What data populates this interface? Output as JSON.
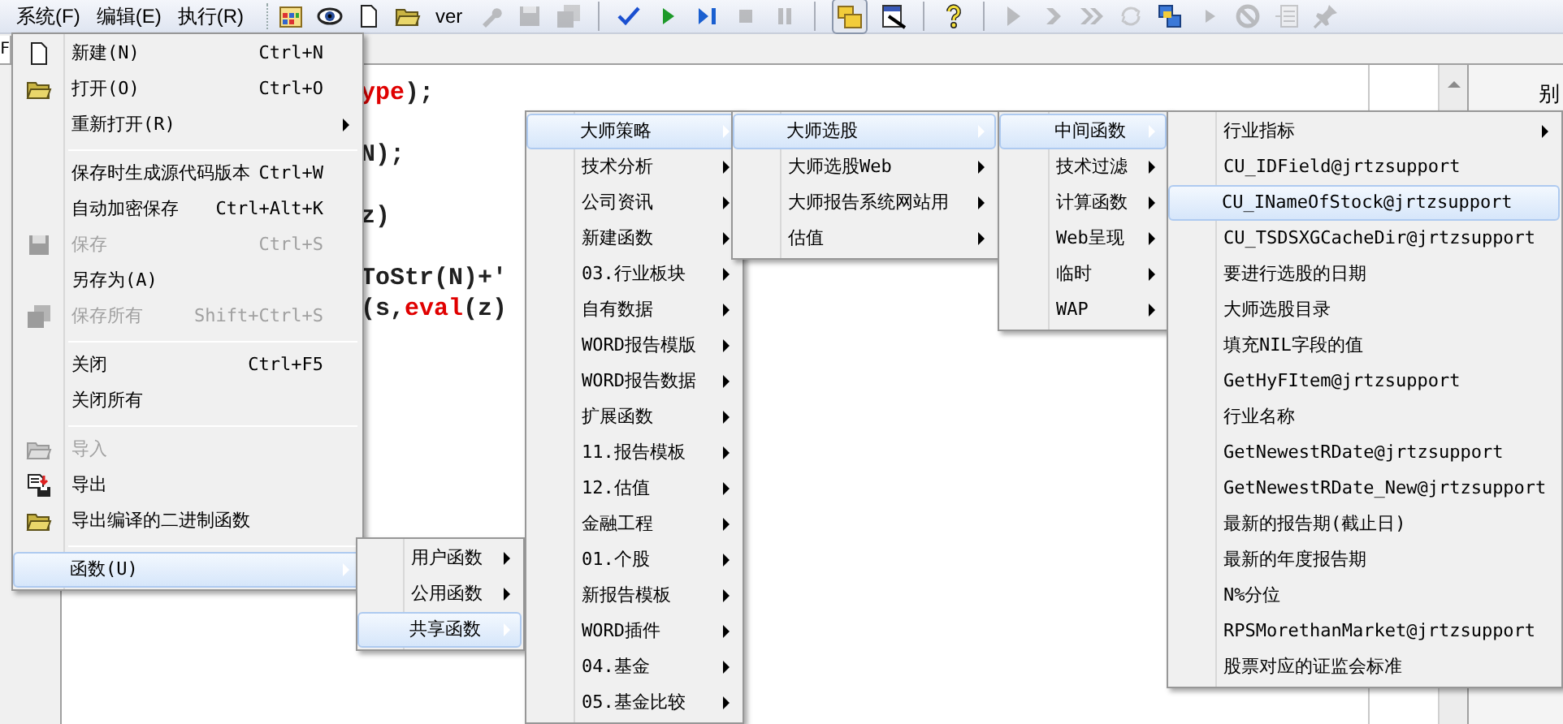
{
  "menubar": [
    {
      "label": "系统(F)"
    },
    {
      "label": "编辑(E)"
    },
    {
      "label": "执行(R)"
    }
  ],
  "toolbar": [
    {
      "kind": "icon",
      "disabled": false
    },
    {
      "kind": "icon",
      "disabled": false
    },
    {
      "kind": "icon",
      "disabled": false
    },
    {
      "kind": "icon",
      "disabled": false
    },
    {
      "kind": "text",
      "label": "ver",
      "disabled": false
    },
    {
      "kind": "icon",
      "disabled": true
    },
    {
      "kind": "icon",
      "disabled": true
    },
    {
      "kind": "icon",
      "disabled": true
    },
    {
      "kind": "separator"
    },
    {
      "kind": "icon",
      "disabled": false
    },
    {
      "kind": "icon",
      "disabled": false
    },
    {
      "kind": "icon",
      "disabled": false
    },
    {
      "kind": "icon",
      "disabled": true
    },
    {
      "kind": "icon",
      "disabled": true
    },
    {
      "kind": "separator"
    },
    {
      "kind": "icon",
      "disabled": false,
      "pressed": true
    },
    {
      "kind": "icon",
      "disabled": false
    },
    {
      "kind": "separator"
    },
    {
      "kind": "icon",
      "disabled": false
    },
    {
      "kind": "separator"
    },
    {
      "kind": "icon",
      "disabled": true
    },
    {
      "kind": "icon",
      "disabled": true
    },
    {
      "kind": "icon",
      "disabled": true
    },
    {
      "kind": "icon",
      "disabled": true
    },
    {
      "kind": "icon",
      "disabled": false
    },
    {
      "kind": "icon",
      "disabled": true
    },
    {
      "kind": "icon",
      "disabled": true
    },
    {
      "kind": "icon",
      "disabled": true
    },
    {
      "kind": "icon",
      "disabled": true
    }
  ],
  "tab_label": "F",
  "code_lines": [
    [
      {
        "text": "ype",
        "kind": "keyword"
      },
      {
        "text": ");",
        "kind": "plain"
      }
    ],
    [
      {
        "text": "N);",
        "kind": "plain"
      }
    ],
    [
      {
        "text": "z)",
        "kind": "plain"
      }
    ],
    [
      {
        "text": "ToStr(N)+'",
        "kind": "plain"
      }
    ],
    [
      {
        "text": "(s,",
        "kind": "plain"
      },
      {
        "text": "eval",
        "kind": "keyword"
      },
      {
        "text": "(z)",
        "kind": "plain"
      }
    ]
  ],
  "side_panel": {
    "title": "别"
  },
  "menus": [
    {
      "items": [
        {
          "label": "新建(N)",
          "shortcut": "Ctrl+N",
          "disabled": false,
          "selected": false,
          "submenu": false
        },
        {
          "label": "打开(O)",
          "shortcut": "Ctrl+O",
          "disabled": false,
          "selected": false,
          "submenu": false
        },
        {
          "label": "重新打开(R)",
          "disabled": false,
          "selected": false,
          "submenu": true
        },
        {
          "kind": "separator"
        },
        {
          "label": "保存时生成源代码版本",
          "shortcut": "Ctrl+W",
          "disabled": false,
          "selected": false,
          "submenu": false
        },
        {
          "label": "自动加密保存",
          "shortcut": "Ctrl+Alt+K",
          "disabled": false,
          "selected": false,
          "submenu": false
        },
        {
          "label": "保存",
          "shortcut": "Ctrl+S",
          "disabled": true,
          "selected": false,
          "submenu": false
        },
        {
          "label": "另存为(A)",
          "disabled": false,
          "selected": false,
          "submenu": false
        },
        {
          "label": "保存所有",
          "shortcut": "Shift+Ctrl+S",
          "disabled": true,
          "selected": false,
          "submenu": false
        },
        {
          "kind": "separator"
        },
        {
          "label": "关闭",
          "shortcut": "Ctrl+F5",
          "disabled": false,
          "selected": false,
          "submenu": false
        },
        {
          "label": "关闭所有",
          "disabled": false,
          "selected": false,
          "submenu": false
        },
        {
          "kind": "separator"
        },
        {
          "label": "导入",
          "disabled": true,
          "selected": false,
          "submenu": false
        },
        {
          "label": "导出",
          "disabled": false,
          "selected": false,
          "submenu": false
        },
        {
          "label": "导出编译的二进制函数",
          "disabled": false,
          "selected": false,
          "submenu": false
        },
        {
          "kind": "separator"
        },
        {
          "label": "函数(U)",
          "disabled": false,
          "selected": true,
          "submenu": true
        }
      ]
    },
    {
      "items": [
        {
          "label": "用户函数",
          "disabled": false,
          "selected": false,
          "submenu": true
        },
        {
          "label": "公用函数",
          "disabled": false,
          "selected": false,
          "submenu": true
        },
        {
          "label": "共享函数",
          "disabled": false,
          "selected": true,
          "submenu": true
        }
      ]
    },
    {
      "items": [
        {
          "label": "大师策略",
          "disabled": false,
          "selected": true,
          "submenu": true
        },
        {
          "label": "技术分析",
          "disabled": false,
          "selected": false,
          "submenu": true
        },
        {
          "label": "公司资讯",
          "disabled": false,
          "selected": false,
          "submenu": true
        },
        {
          "label": "新建函数",
          "disabled": false,
          "selected": false,
          "submenu": true
        },
        {
          "label": "03.行业板块",
          "disabled": false,
          "selected": false,
          "submenu": true
        },
        {
          "label": "自有数据",
          "disabled": false,
          "selected": false,
          "submenu": true
        },
        {
          "label": "WORD报告模版",
          "disabled": false,
          "selected": false,
          "submenu": true
        },
        {
          "label": "WORD报告数据",
          "disabled": false,
          "selected": false,
          "submenu": true
        },
        {
          "label": "扩展函数",
          "disabled": false,
          "selected": false,
          "submenu": true
        },
        {
          "label": "11.报告模板",
          "disabled": false,
          "selected": false,
          "submenu": true
        },
        {
          "label": "12.估值",
          "disabled": false,
          "selected": false,
          "submenu": true
        },
        {
          "label": "金融工程",
          "disabled": false,
          "selected": false,
          "submenu": true
        },
        {
          "label": "01.个股",
          "disabled": false,
          "selected": false,
          "submenu": true
        },
        {
          "label": "新报告模板",
          "disabled": false,
          "selected": false,
          "submenu": true
        },
        {
          "label": "WORD插件",
          "disabled": false,
          "selected": false,
          "submenu": true
        },
        {
          "label": "04.基金",
          "disabled": false,
          "selected": false,
          "submenu": true
        },
        {
          "label": "05.基金比较",
          "disabled": false,
          "selected": false,
          "submenu": true
        }
      ]
    },
    {
      "items": [
        {
          "label": "大师选股",
          "disabled": false,
          "selected": true,
          "submenu": true
        },
        {
          "label": "大师选股Web",
          "disabled": false,
          "selected": false,
          "submenu": true
        },
        {
          "label": "大师报告系统网站用",
          "disabled": false,
          "selected": false,
          "submenu": true
        },
        {
          "label": "估值",
          "disabled": false,
          "selected": false,
          "submenu": true
        }
      ]
    },
    {
      "items": [
        {
          "label": "中间函数",
          "disabled": false,
          "selected": true,
          "submenu": true
        },
        {
          "label": "技术过滤",
          "disabled": false,
          "selected": false,
          "submenu": true
        },
        {
          "label": "计算函数",
          "disabled": false,
          "selected": false,
          "submenu": true
        },
        {
          "label": "Web呈现",
          "disabled": false,
          "selected": false,
          "submenu": true
        },
        {
          "label": "临时",
          "disabled": false,
          "selected": false,
          "submenu": true
        },
        {
          "label": "WAP",
          "disabled": false,
          "selected": false,
          "submenu": true
        }
      ]
    },
    {
      "items": [
        {
          "label": "行业指标",
          "disabled": false,
          "selected": false,
          "submenu": true
        },
        {
          "label": "CU_IDField@jrtzsupport",
          "disabled": false,
          "selected": false,
          "submenu": false
        },
        {
          "label": "CU_INameOfStock@jrtzsupport",
          "disabled": false,
          "selected": true,
          "submenu": false
        },
        {
          "label": "CU_TSDSXGCacheDir@jrtzsupport",
          "disabled": false,
          "selected": false,
          "submenu": false
        },
        {
          "label": "要进行选股的日期",
          "disabled": false,
          "selected": false,
          "submenu": false
        },
        {
          "label": "大师选股目录",
          "disabled": false,
          "selected": false,
          "submenu": false
        },
        {
          "label": "填充NIL字段的值",
          "disabled": false,
          "selected": false,
          "submenu": false
        },
        {
          "label": "GetHyFItem@jrtzsupport",
          "disabled": false,
          "selected": false,
          "submenu": false
        },
        {
          "label": "行业名称",
          "disabled": false,
          "selected": false,
          "submenu": false
        },
        {
          "label": "GetNewestRDate@jrtzsupport",
          "disabled": false,
          "selected": false,
          "submenu": false
        },
        {
          "label": "GetNewestRDate_New@jrtzsupport",
          "disabled": false,
          "selected": false,
          "submenu": false
        },
        {
          "label": "最新的报告期(截止日)",
          "disabled": false,
          "selected": false,
          "submenu": false
        },
        {
          "label": "最新的年度报告期",
          "disabled": false,
          "selected": false,
          "submenu": false
        },
        {
          "label": "N%分位",
          "disabled": false,
          "selected": false,
          "submenu": false
        },
        {
          "label": "RPSMorethanMarket@jrtzsupport",
          "disabled": false,
          "selected": false,
          "submenu": false
        },
        {
          "label": "股票对应的证监会标准",
          "disabled": false,
          "selected": false,
          "submenu": false
        }
      ]
    }
  ]
}
